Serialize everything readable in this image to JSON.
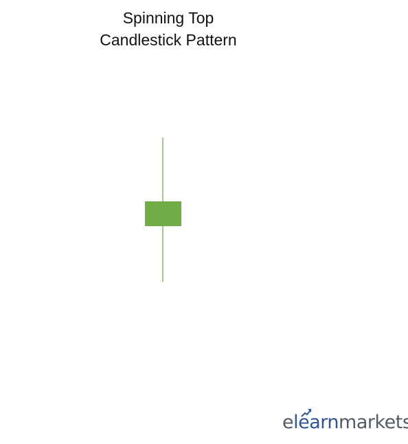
{
  "title": {
    "line1": "Spinning Top",
    "line2": "Candlestick Pattern"
  },
  "candle": {
    "color": "#70ad47",
    "type": "bullish"
  },
  "logo": {
    "text_1": "e",
    "text_2": "learn",
    "text_3": "markets",
    "color_dark": "#555a66",
    "color_accent": "#2f5597",
    "icon": "trend-arrow-icon"
  },
  "colors": {
    "background": "#ffffff",
    "title_text": "#111111"
  }
}
